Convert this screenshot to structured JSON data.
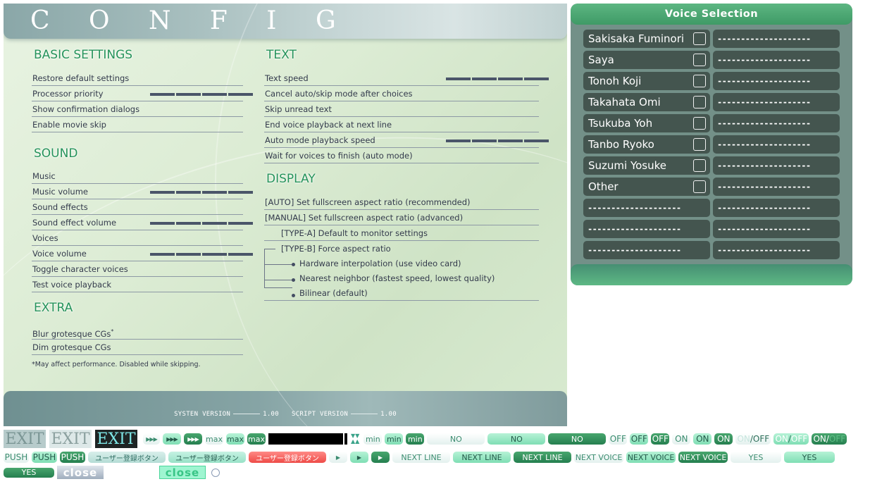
{
  "config": {
    "title": "C O N F I G",
    "basic_settings": {
      "heading": "BASIC SETTINGS",
      "items": [
        {
          "label": "Restore default settings"
        },
        {
          "label": "Processor priority",
          "slider_level": 1.0
        },
        {
          "label": "Show confirmation dialogs"
        },
        {
          "label": "Enable movie skip"
        }
      ]
    },
    "sound": {
      "heading": "SOUND",
      "items": [
        {
          "label": "Music"
        },
        {
          "label": "Music volume",
          "slider_level": 1.0
        },
        {
          "label": "Sound effects"
        },
        {
          "label": "Sound effect volume",
          "slider_level": 1.0
        },
        {
          "label": "Voices"
        },
        {
          "label": "Voice volume",
          "slider_level": 1.0
        },
        {
          "label": "Toggle character voices"
        },
        {
          "label": "Test voice playback"
        }
      ]
    },
    "extra": {
      "heading": "EXTRA",
      "items": [
        {
          "label": "Blur grotesque CGs",
          "sup": "*"
        },
        {
          "label": "Dim grotesque CGs"
        }
      ],
      "note": "*May affect performance. Disabled while skipping."
    },
    "text": {
      "heading": "TEXT",
      "items": [
        {
          "label": "Text speed",
          "slider_level": 1.0
        },
        {
          "label": "Cancel auto/skip mode after choices"
        },
        {
          "label": "Skip unread text"
        },
        {
          "label": "End voice playback at next line"
        },
        {
          "label": "Auto mode playback speed",
          "slider_level": 1.0
        },
        {
          "label": "Wait for voices to finish (auto mode)"
        }
      ]
    },
    "display": {
      "heading": "DISPLAY",
      "items": [
        {
          "label": "[AUTO] Set fullscreen aspect ratio (recommended)"
        },
        {
          "label": "[MANUAL] Set fullscreen aspect ratio (advanced)"
        },
        {
          "label": "[TYPE-A] Default to monitor settings"
        },
        {
          "label": "[TYPE-B] Force aspect ratio"
        },
        {
          "label": "Hardware interpolation (use video card)"
        },
        {
          "label": "Nearest neighbor (fastest speed, lowest quality)"
        },
        {
          "label": "Bilinear (default)"
        }
      ]
    },
    "footer": {
      "system_label": "SYSTEN VERSION",
      "system_version": "1.00",
      "script_label": "SCRIPT VERSION",
      "script_version": "1.00"
    }
  },
  "voice_selection": {
    "title": "Voice Selection",
    "rows": [
      {
        "name": "Sakisaka Fuminori",
        "checked": false,
        "right": "--------------------"
      },
      {
        "name": "Saya",
        "checked": false,
        "right": "--------------------"
      },
      {
        "name": "Tonoh Koji",
        "checked": false,
        "right": "--------------------"
      },
      {
        "name": "Takahata Omi",
        "checked": false,
        "right": "--------------------"
      },
      {
        "name": "Tsukuba Yoh",
        "checked": false,
        "right": "--------------------"
      },
      {
        "name": "Tanbo Ryoko",
        "checked": false,
        "right": "--------------------"
      },
      {
        "name": "Suzumi Yosuke",
        "checked": false,
        "right": "--------------------"
      },
      {
        "name": "Other",
        "checked": false,
        "right": "--------------------"
      },
      {
        "name": "--------------------",
        "right": "--------------------"
      },
      {
        "name": "--------------------",
        "right": "--------------------"
      },
      {
        "name": "--------------------",
        "right": "--------------------"
      }
    ]
  },
  "sprites": {
    "exit": "EXIT",
    "ff": "▶▶▶",
    "max": "max",
    "min": "min",
    "no": "NO",
    "off": "OFF",
    "on": "ON",
    "on_part": "ON",
    "slash": "/",
    "off_part": "OFF",
    "push": "PUSH",
    "user_reg": "ユーザー登録ボタン",
    "play": "▶",
    "next_line": "NEXT LINE",
    "next_voice": "NEXT VOICE",
    "yes": "YES",
    "close": "close"
  }
}
